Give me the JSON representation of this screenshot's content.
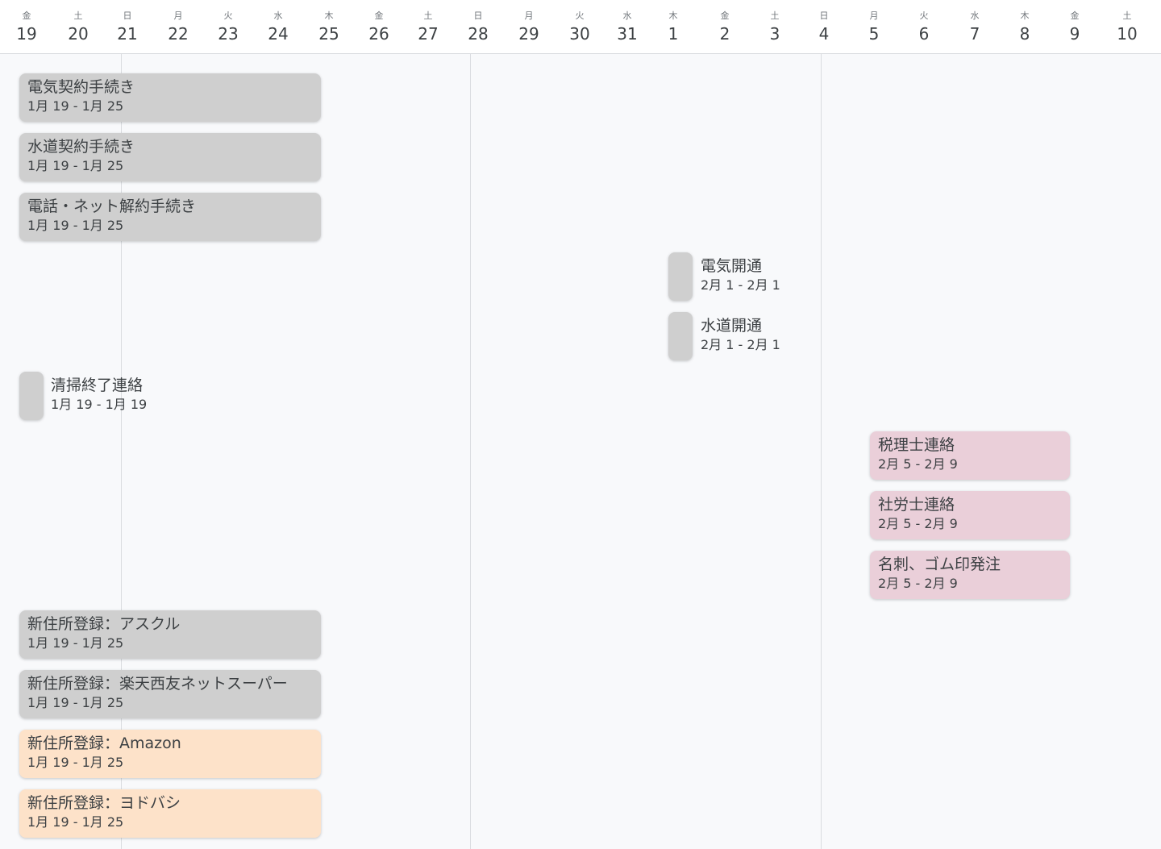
{
  "colors": {
    "gray": "#cfcfcf",
    "peach": "#fde2c9",
    "pink": "#eacfd9",
    "gridline": "#dadce0",
    "background": "#f8f9fb"
  },
  "timeline": {
    "days": [
      {
        "dow": "金",
        "num": "19"
      },
      {
        "dow": "土",
        "num": "20"
      },
      {
        "dow": "日",
        "num": "21"
      },
      {
        "dow": "月",
        "num": "22"
      },
      {
        "dow": "火",
        "num": "23"
      },
      {
        "dow": "水",
        "num": "24"
      },
      {
        "dow": "木",
        "num": "25"
      },
      {
        "dow": "金",
        "num": "26"
      },
      {
        "dow": "土",
        "num": "27"
      },
      {
        "dow": "日",
        "num": "28"
      },
      {
        "dow": "月",
        "num": "29"
      },
      {
        "dow": "火",
        "num": "30"
      },
      {
        "dow": "水",
        "num": "31"
      },
      {
        "dow": "木",
        "num": "1"
      },
      {
        "dow": "金",
        "num": "2"
      },
      {
        "dow": "土",
        "num": "3"
      },
      {
        "dow": "日",
        "num": "4"
      },
      {
        "dow": "月",
        "num": "5"
      },
      {
        "dow": "火",
        "num": "6"
      },
      {
        "dow": "水",
        "num": "7"
      },
      {
        "dow": "木",
        "num": "8"
      },
      {
        "dow": "金",
        "num": "9"
      },
      {
        "dow": "土",
        "num": "10"
      }
    ]
  },
  "events": [
    {
      "title": "電気契約手続き",
      "dates": "1月 19 - 1月 25",
      "color": "gray"
    },
    {
      "title": "水道契約手続き",
      "dates": "1月 19 - 1月 25",
      "color": "gray"
    },
    {
      "title": "電話・ネット解約手続き",
      "dates": "1月 19 - 1月 25",
      "color": "gray"
    },
    {
      "title": "電気開通",
      "dates": "2月 1 - 2月 1",
      "color": "gray"
    },
    {
      "title": "水道開通",
      "dates": "2月 1 - 2月 1",
      "color": "gray"
    },
    {
      "title": "清掃終了連絡",
      "dates": "1月 19 - 1月 19",
      "color": "gray"
    },
    {
      "title": "税理士連絡",
      "dates": "2月 5 - 2月 9",
      "color": "pink"
    },
    {
      "title": "社労士連絡",
      "dates": "2月 5 - 2月 9",
      "color": "pink"
    },
    {
      "title": "名刺、ゴム印発注",
      "dates": "2月 5 - 2月 9",
      "color": "pink"
    },
    {
      "title": "新住所登録：アスクル",
      "dates": "1月 19 - 1月 25",
      "color": "gray"
    },
    {
      "title": "新住所登録：楽天西友ネットスーパー",
      "dates": "1月 19 - 1月 25",
      "color": "gray"
    },
    {
      "title": "新住所登録：Amazon",
      "dates": "1月 19 - 1月 25",
      "color": "peach"
    },
    {
      "title": "新住所登録：ヨドバシ",
      "dates": "1月 19 - 1月 25",
      "color": "peach"
    }
  ]
}
